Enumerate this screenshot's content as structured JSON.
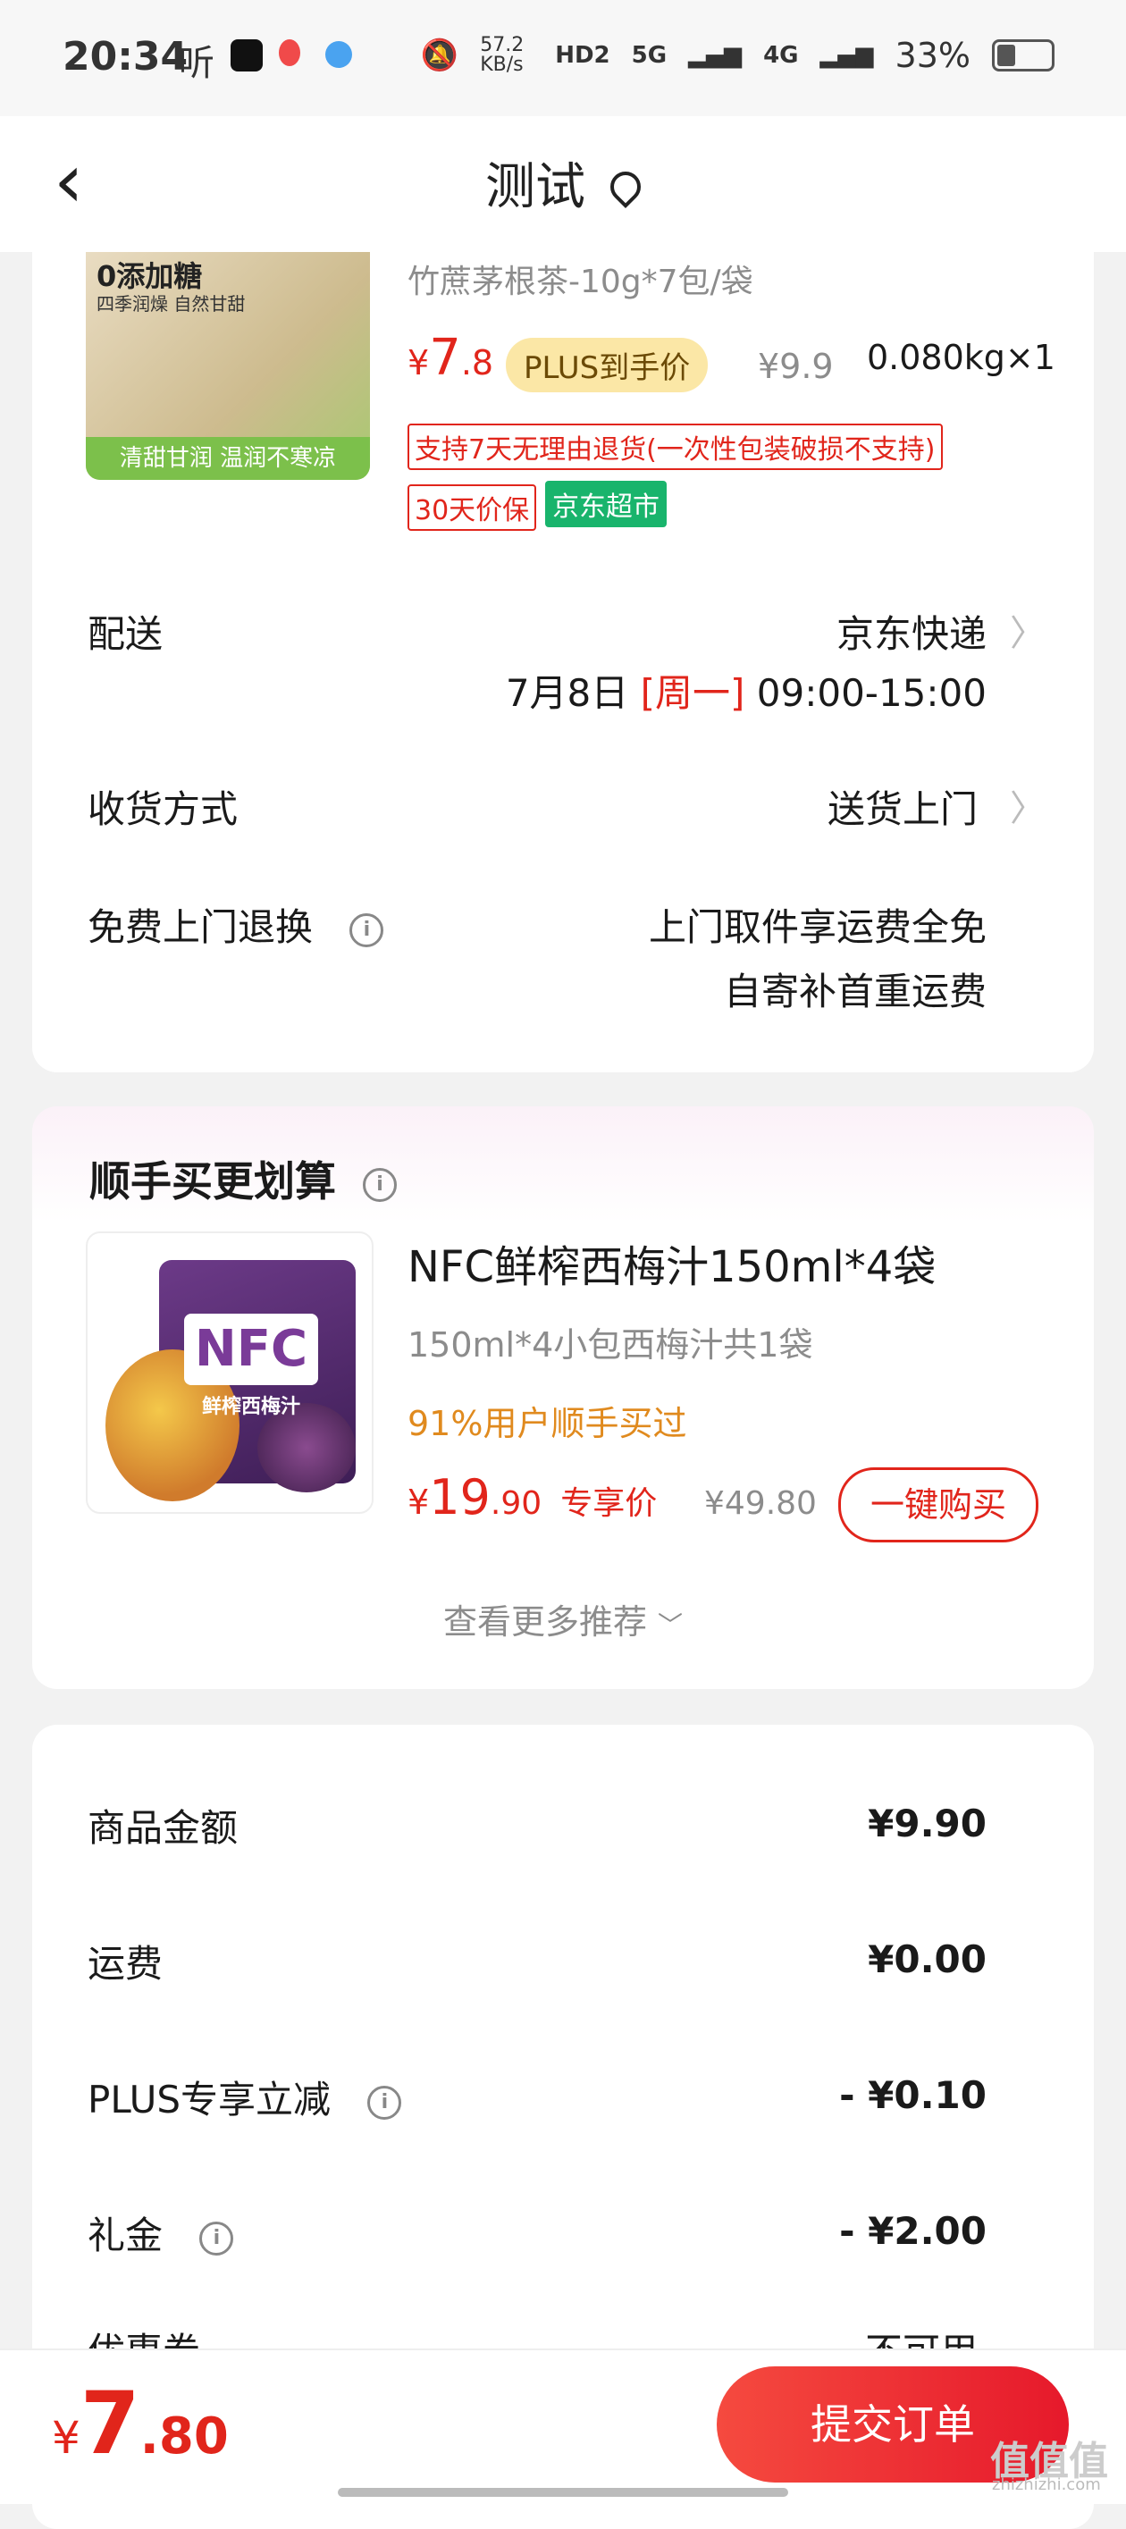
{
  "status_bar": {
    "time": "20:34",
    "listen_glyph": "听",
    "net_speed": "57.2 KB/s",
    "hd_badge": "HD2",
    "net_5g": "5G",
    "net_4g": "4G",
    "battery": "33%"
  },
  "nav": {
    "back_glyph": "‹",
    "title": "测试"
  },
  "product1": {
    "image_head": "0添加糖",
    "image_sub": "四季润燥 自然甘甜",
    "image_banner": "清甜甘润 温润不寒凉",
    "spec": "竹蔗茅根茶-10g*7包/袋",
    "price_symbol": "¥",
    "price_int": "7",
    "price_dec": ".8",
    "plus_label": "PLUS到手价",
    "orig_price": "¥9.9",
    "weight_qty": "0.080kg×1",
    "tag_return": "支持7天无理由退货(一次性包装破损不支持)",
    "tag_price_protect": "30天价保",
    "tag_store": "京东超市"
  },
  "delivery": {
    "label": "配送",
    "courier": "京东快递",
    "date": "7月8日",
    "weekday": "[周一]",
    "time_window": "09:00-15:00"
  },
  "receive": {
    "label": "收货方式",
    "value": "送货上门"
  },
  "free_return": {
    "label": "免费上门退换",
    "line1": "上门取件享运费全免",
    "line2": "自寄补首重运费"
  },
  "addon": {
    "title": "顺手买更划算",
    "product_image_text": "NFC",
    "product_image_sub": "鲜榨西梅汁",
    "product_name": "NFC鲜榨西梅汁150ml*4袋",
    "product_spec": "150ml*4小包西梅汁共1袋",
    "social_proof": "91%用户顺手买过",
    "price_symbol": "¥",
    "price_int": "19",
    "price_dec": ".90",
    "price_label": "专享价",
    "orig_price": "¥49.80",
    "buy_button": "一键购买",
    "more": "查看更多推荐"
  },
  "summary": {
    "rows": [
      {
        "label": "商品金额",
        "value": "¥9.90"
      },
      {
        "label": "运费",
        "value": "¥0.00"
      },
      {
        "label": "PLUS专享立减",
        "value": "- ¥0.10"
      },
      {
        "label": "礼金",
        "value": "- ¥2.00"
      },
      {
        "label": "优惠券",
        "value": "不可用"
      }
    ]
  },
  "bottom": {
    "price_symbol": "¥",
    "price_int": "7",
    "price_dec": ".80",
    "submit": "提交订单"
  },
  "watermark": {
    "logo": "值值值",
    "url": "zhizhizhi.com"
  },
  "colors": {
    "accent_red": "#e1251b",
    "store_green": "#19b46c",
    "plus_gold": "#fbe7a6"
  }
}
